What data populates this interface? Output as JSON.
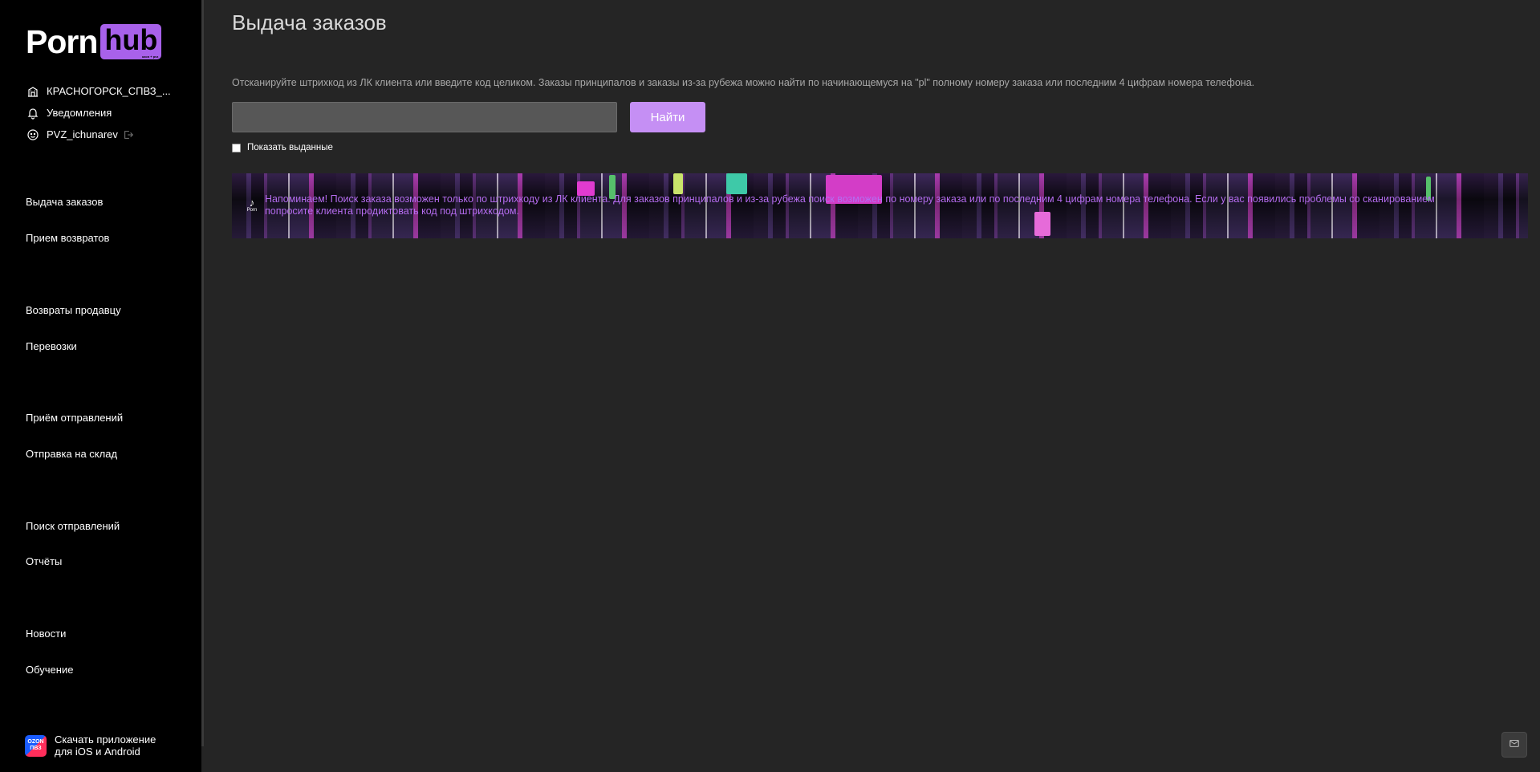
{
  "logo": {
    "left": "Porn",
    "right": "hub",
    "sub": "ozon + pvz"
  },
  "user": {
    "location": "КРАСНОГОРСК_СПВЗ_...",
    "notifications": "Уведомления",
    "username": "PVZ_ichunarev"
  },
  "nav": {
    "items": [
      "Выдача заказов",
      "Прием возвратов",
      "Возвраты продавцу",
      "Перевозки",
      "Приём отправлений",
      "Отправка на склад",
      "Поиск отправлений",
      "Отчёты",
      "Новости",
      "Обучение"
    ]
  },
  "app_promo": {
    "badge_top": "OZON",
    "badge_bottom": "ПВЗ",
    "line1": "Скачать приложение",
    "line2": "для iOS и Android"
  },
  "main": {
    "title": "Выдача заказов",
    "hint": "Отсканируйте штрихкод из ЛК клиента или введите код целиком. Заказы принципалов и заказы из-за рубежа можно найти по начинающемуся на \"pl\" полному номеру заказа или последним 4 цифрам номера телефона.",
    "search_value": "",
    "find_label": "Найти",
    "show_issued_label": "Показать выданные",
    "notice_icon_label": "Porn",
    "notice_text": "Напоминаем! Поиск заказа возможен только по штрихкоду из ЛК клиента. Для заказов принципалов и из-за рубежа поиск возможен по номеру заказа или по последним 4 цифрам номера телефона. Если у вас появились проблемы со сканированием попросите клиента продиктовать код под штрихкодом."
  },
  "colors": {
    "accent": "#a861ea",
    "button": "#c58ff4",
    "notice_text": "#b56cf0",
    "background": "#252525",
    "sidebar": "#000000"
  },
  "icons": {
    "location": "building-icon",
    "notifications": "bell-icon",
    "user": "user-face-icon",
    "logout": "logout-icon",
    "mail": "mail-icon"
  }
}
